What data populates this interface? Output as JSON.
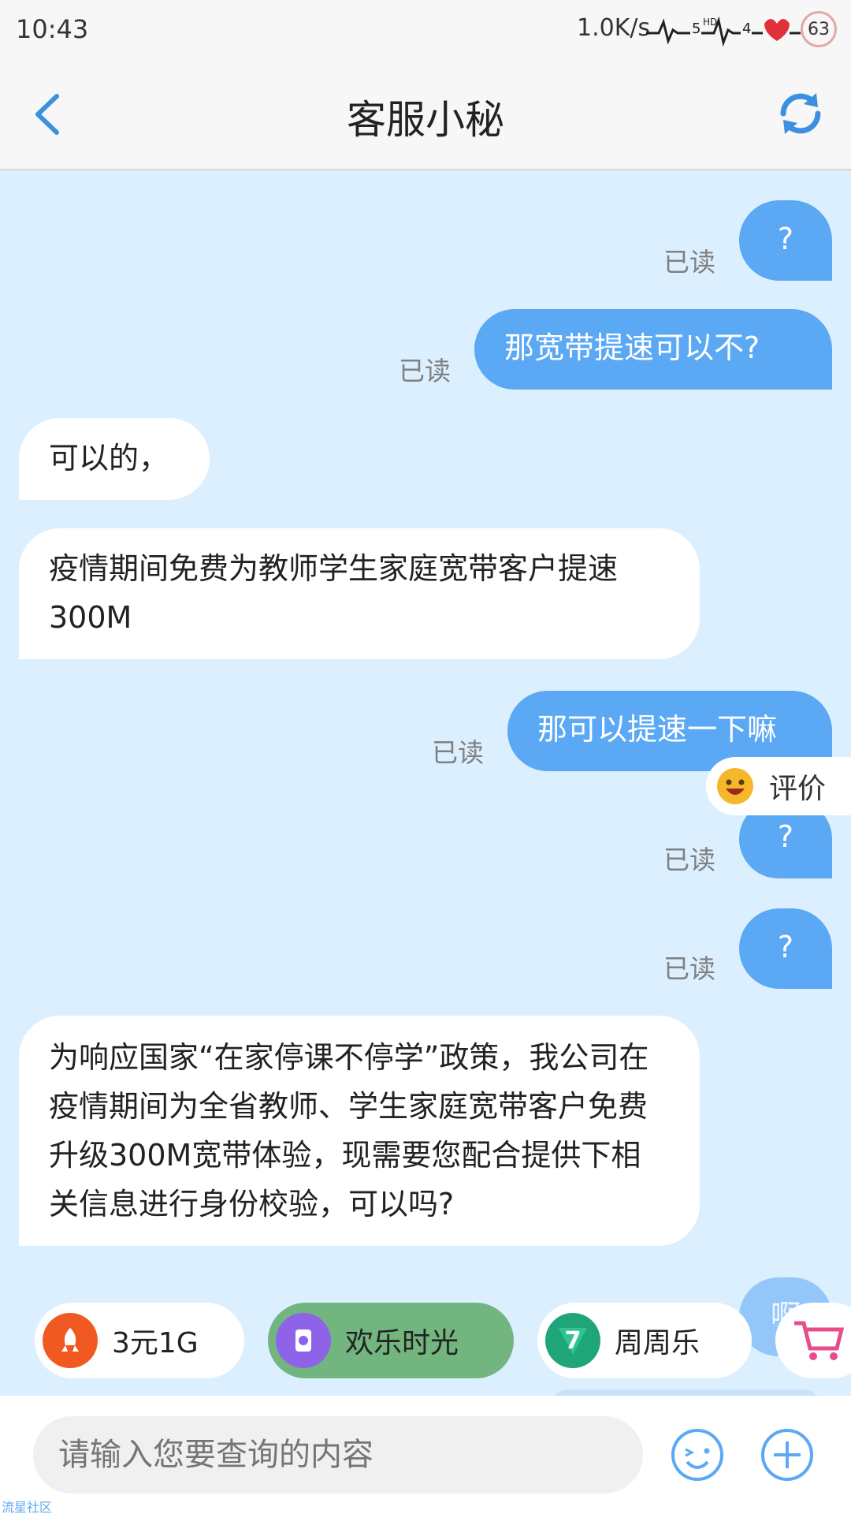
{
  "status_bar": {
    "time": "10:43",
    "speed": "1.0K/s",
    "battery": "63"
  },
  "header": {
    "title": "客服小秘"
  },
  "messages": [
    {
      "side": "right",
      "text": "?",
      "read": "已读"
    },
    {
      "side": "right",
      "text": "那宽带提速可以不?",
      "read": "已读"
    },
    {
      "side": "left",
      "text": "可以的，"
    },
    {
      "side": "left",
      "text": "疫情期间免费为教师学生家庭宽带客户提速300M"
    },
    {
      "side": "right",
      "text": "那可以提速一下嘛",
      "read": "已读"
    },
    {
      "side": "right",
      "text": "?",
      "read": "已读"
    },
    {
      "side": "right",
      "text": "?",
      "read": "已读"
    },
    {
      "side": "left",
      "text": "为响应国家“在家停课不停学”政策，我公司在疫情期间为全省教师、学生家庭宽带客户免费升级300M宽带体验，现需要您配合提供下相关信息进行身份校验，可以吗?"
    }
  ],
  "partial_bubble_text": "啊",
  "rate": {
    "label": "评价"
  },
  "quick_replies": [
    {
      "label": "3元1G",
      "color": "#f05a22"
    },
    {
      "label": "欢乐时光",
      "color": "#8e63e8"
    },
    {
      "label": "周周乐",
      "color": "#1fa57a"
    }
  ],
  "input": {
    "placeholder": "请输入您要查询的内容"
  },
  "watermark": "流星社区",
  "colors": {
    "accent": "#5ba8f5",
    "chat_bg": "#dcefff",
    "chip_active": "#73b57e"
  }
}
